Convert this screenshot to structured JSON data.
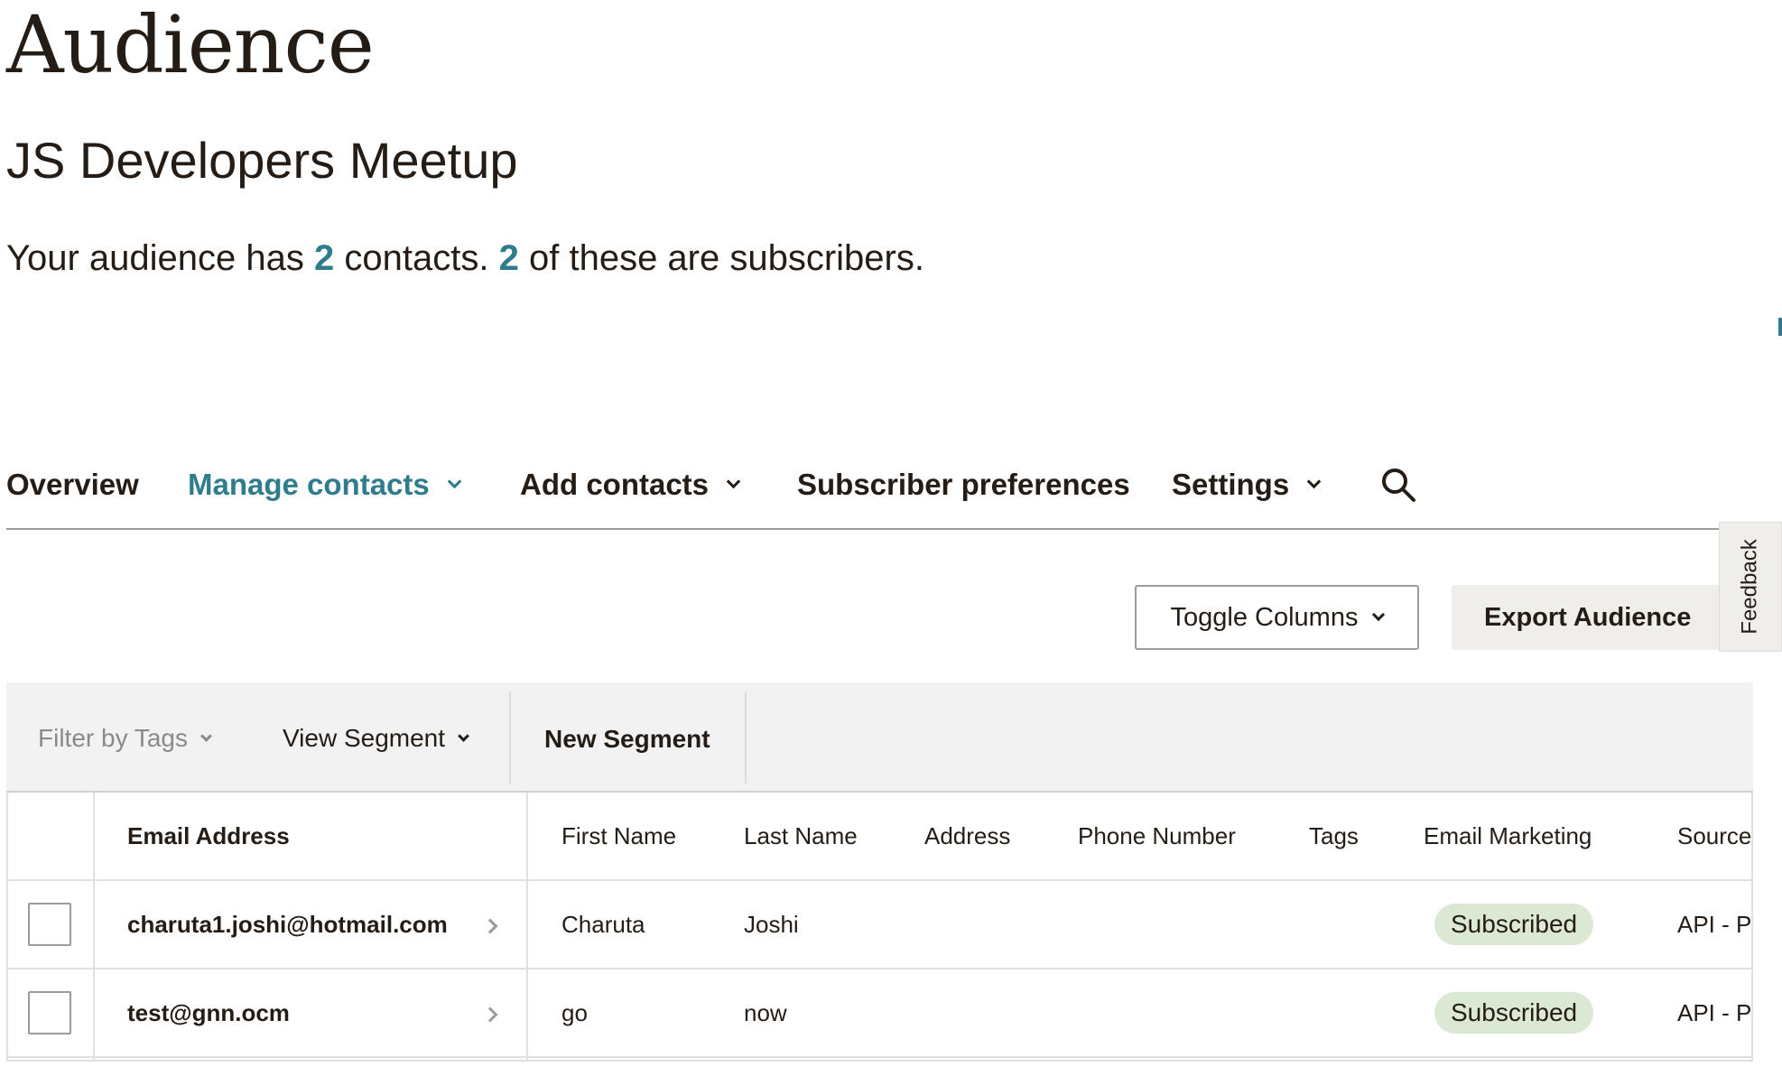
{
  "page": {
    "title": "Audience",
    "audience_name": "JS Developers Meetup",
    "summary": {
      "prefix": "Your audience has",
      "contacts_count": "2",
      "middle": "contacts.",
      "subscribers_count": "2",
      "suffix": "of these are subscribers."
    }
  },
  "nav": {
    "items": [
      {
        "label": "Overview",
        "active": false,
        "has_dropdown": false
      },
      {
        "label": "Manage contacts",
        "active": true,
        "has_dropdown": true
      },
      {
        "label": "Add contacts",
        "active": false,
        "has_dropdown": true
      },
      {
        "label": "Subscriber preferences",
        "active": false,
        "has_dropdown": false
      },
      {
        "label": "Settings",
        "active": false,
        "has_dropdown": true
      }
    ],
    "search_icon": "search-icon"
  },
  "actions": {
    "toggle_columns_label": "Toggle Columns",
    "export_label": "Export Audience"
  },
  "feedback": {
    "label": "Feedback"
  },
  "filters": {
    "filter_by_tags": "Filter by Tags",
    "view_segment": "View Segment",
    "new_segment": "New Segment"
  },
  "table": {
    "columns": [
      "Email Address",
      "First Name",
      "Last Name",
      "Address",
      "Phone Number",
      "Tags",
      "Email Marketing",
      "Source"
    ],
    "rows": [
      {
        "email": "charuta1.joshi@hotmail.com",
        "first_name": "Charuta",
        "last_name": "Joshi",
        "address": "",
        "phone": "",
        "tags": "",
        "email_marketing": "Subscribed",
        "source": "API - Po"
      },
      {
        "email": "test@gnn.ocm",
        "first_name": "go",
        "last_name": "now",
        "address": "",
        "phone": "",
        "tags": "",
        "email_marketing": "Subscribed",
        "source": "API - Po"
      }
    ]
  },
  "colors": {
    "accent": "#2f7d8c",
    "badge_bg": "#dbe9d4",
    "text": "#241c15",
    "button_bg": "#efeeea"
  }
}
